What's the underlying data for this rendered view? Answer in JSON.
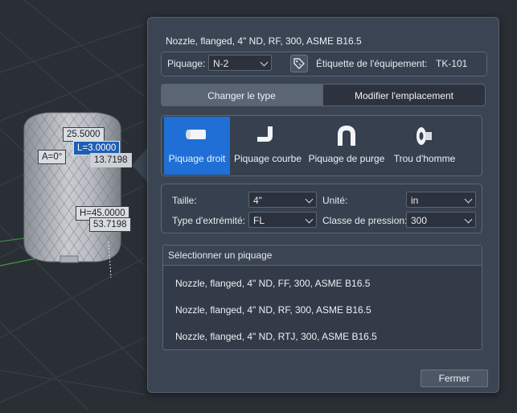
{
  "viewport": {
    "dimensions": {
      "top": "25.5000",
      "length": "L=3.0000",
      "angle": "A=0°",
      "offset1": "13.7198",
      "height": "H=45.0000",
      "offset2": "53.7198"
    }
  },
  "panel": {
    "title": "Nozzle, flanged, 4\" ND, RF, 300, ASME B16.5",
    "piquage_label": "Piquage:",
    "piquage_value": "N-2",
    "equipment_label": "Étiquette de l'équipement:",
    "equipment_value": "TK-101",
    "tabs": [
      {
        "label": "Changer le type",
        "active": true
      },
      {
        "label": "Modifier l'emplacement",
        "active": false
      }
    ],
    "types": [
      {
        "label": "Piquage droit",
        "icon": "straight-nozzle-icon",
        "selected": true
      },
      {
        "label": "Piquage courbe",
        "icon": "bent-nozzle-icon",
        "selected": false
      },
      {
        "label": "Piquage de purge",
        "icon": "vent-nozzle-icon",
        "selected": false
      },
      {
        "label": "Trou d'homme",
        "icon": "manhole-icon",
        "selected": false
      }
    ],
    "props": {
      "size_label": "Taille:",
      "size_value": "4\"",
      "unit_label": "Unité:",
      "unit_value": "in",
      "end_label": "Type d'extrémité:",
      "end_value": "FL",
      "pressure_label": "Classe de pression:",
      "pressure_value": "300"
    },
    "select": {
      "header": "Sélectionner un piquage",
      "items": [
        "Nozzle, flanged, 4\" ND, FF, 300, ASME B16.5",
        "Nozzle, flanged, 4\" ND, RF, 300, ASME B16.5",
        "Nozzle, flanged, 4\" ND, RTJ, 300, ASME B16.5"
      ]
    },
    "close_label": "Fermer"
  },
  "colors": {
    "panel_bg": "#3b4453",
    "accent": "#1f6fd6",
    "viewport_bg": "#2a2f36"
  }
}
